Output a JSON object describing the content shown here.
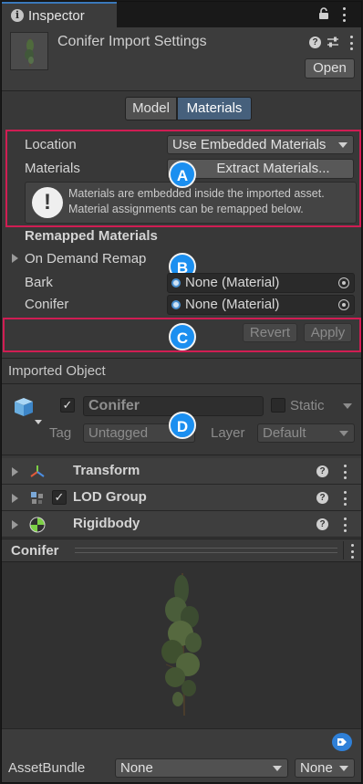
{
  "window": {
    "tab_title": "Inspector",
    "icons": [
      "info-icon",
      "lock-icon",
      "kebab-menu-icon"
    ]
  },
  "header": {
    "title": "Conifer Import Settings",
    "open_label": "Open",
    "icons": [
      "help-icon",
      "presets-icon",
      "kebab-menu-icon"
    ]
  },
  "tabs": {
    "items": [
      {
        "label": "Model",
        "active": false
      },
      {
        "label": "Materials",
        "active": true
      }
    ]
  },
  "materials": {
    "location_label": "Location",
    "location_value": "Use Embedded Materials",
    "materials_label": "Materials",
    "extract_label": "Extract Materials...",
    "help_line1": "Materials are embedded inside the imported asset.",
    "help_line2": "Material assignments can be remapped below."
  },
  "remapped": {
    "title": "Remapped Materials",
    "on_demand_label": "On Demand Remap",
    "rows": [
      {
        "label": "Bark",
        "value": "None (Material)"
      },
      {
        "label": "Conifer",
        "value": "None (Material)"
      }
    ],
    "revert_label": "Revert",
    "apply_label": "Apply"
  },
  "imported_object": {
    "section_title": "Imported Object",
    "name": "Conifer",
    "active_checked": true,
    "static_label": "Static",
    "static_checked": false,
    "tag_label": "Tag",
    "tag_value": "Untagged",
    "layer_label": "Layer",
    "layer_value": "Default"
  },
  "components": [
    {
      "name": "Transform",
      "icon": "transform-icon",
      "has_checkbox": false
    },
    {
      "name": "LOD Group",
      "icon": "lod-group-icon",
      "has_checkbox": true
    },
    {
      "name": "Rigidbody",
      "icon": "rigidbody-icon",
      "has_checkbox": false
    }
  ],
  "preview": {
    "title": "Conifer"
  },
  "asset_bundle": {
    "label": "AssetBundle",
    "name_value": "None",
    "variant_value": "None"
  },
  "markers": {
    "a": "A",
    "b": "B",
    "c": "C",
    "d": "D"
  },
  "colors": {
    "highlight_box": "#d01d53",
    "marker": "#1b8ff0",
    "active_tab": "#3a79bb"
  }
}
